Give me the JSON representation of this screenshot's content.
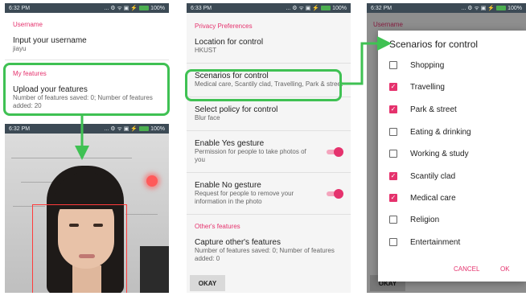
{
  "status": {
    "time": "6:32 PM",
    "time_p3": "6:33 PM",
    "icons": "... ⚙ ᯤ ▣ ⚡",
    "battery": "100%"
  },
  "p1": {
    "username_header": "Username",
    "username_title": "Input your username",
    "username_value": "jiayu",
    "features_header": "My features",
    "upload_title": "Upload your features",
    "upload_summary": "Number of features saved: 0; Number of features added: 20"
  },
  "p3": {
    "privacy_header": "Privacy Preferences",
    "location_title": "Location for control",
    "location_value": "HKUST",
    "scenarios_title": "Scenarios for control",
    "scenarios_value": "Medical care, Scantily clad, Travelling, Park & street",
    "policy_title": "Select policy for control",
    "policy_value": "Blur face",
    "yes_title": "Enable Yes gesture",
    "yes_summary": "Permission for people to take photos of you",
    "no_title": "Enable No gesture",
    "no_summary": "Request for people to remove your information in the photo",
    "others_header": "Other's features",
    "capture_title": "Capture other's features",
    "capture_summary": "Number of features saved: 0; Number of features added: 0",
    "okay": "OKAY"
  },
  "p4": {
    "bg_header": "Username",
    "dialog_title": "Scenarios for control",
    "options": [
      {
        "label": "Shopping",
        "checked": false
      },
      {
        "label": "Travelling",
        "checked": true
      },
      {
        "label": "Park & street",
        "checked": true
      },
      {
        "label": "Eating & drinking",
        "checked": false
      },
      {
        "label": "Working & study",
        "checked": false
      },
      {
        "label": "Scantily clad",
        "checked": true
      },
      {
        "label": "Medical care",
        "checked": true
      },
      {
        "label": "Religion",
        "checked": false
      },
      {
        "label": "Entertainment",
        "checked": false
      }
    ],
    "cancel": "CANCEL",
    "ok": "OK",
    "okay": "OKAY"
  },
  "colors": {
    "accent": "#e5326d",
    "highlight": "#3fc153",
    "statusbar": "#3c4a55"
  }
}
